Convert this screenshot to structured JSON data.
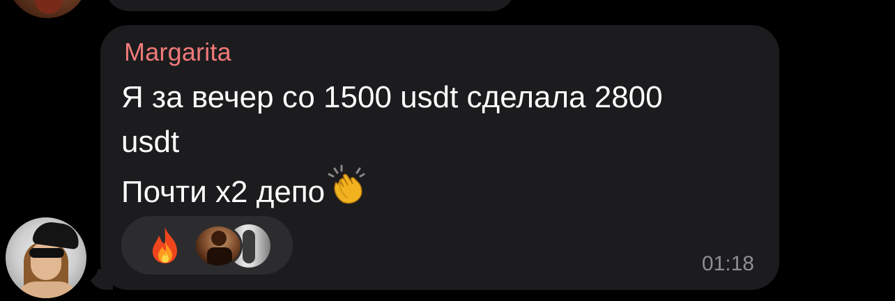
{
  "message": {
    "sender_name": "Margarita",
    "lines": [
      "Я за вечер со 1500 usdt сделала 2800",
      "usdt",
      "Почти х2 депо"
    ],
    "trailing_emoji": "clapping-hands",
    "timestamp": "01:18",
    "reactions": [
      {
        "emoji": "fire",
        "reactor_avatars": 2
      }
    ]
  },
  "colors": {
    "background": "#000000",
    "bubble": "#1c1c1e",
    "reaction_pill": "#2c2c2e",
    "sender_name": "#f07a7a",
    "text": "#ffffff",
    "timestamp": "#8e8e93"
  }
}
